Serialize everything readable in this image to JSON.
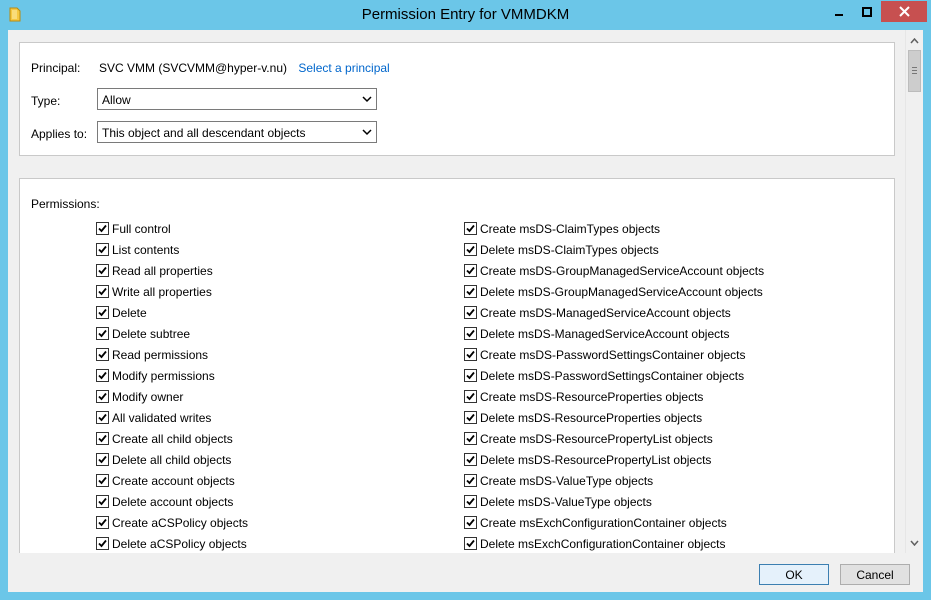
{
  "window": {
    "title": "Permission Entry for VMMDKM",
    "controls": {
      "minimize_icon": "minimize-icon",
      "maximize_icon": "maximize-icon",
      "close_icon": "close-icon"
    },
    "accent_color": "#6bc6e8",
    "close_color": "#c75050"
  },
  "principal": {
    "label": "Principal:",
    "value": "SVC VMM (SVCVMM@hyper-v.nu)",
    "select_link": "Select a principal"
  },
  "type": {
    "label": "Type:",
    "selected": "Allow"
  },
  "applies_to": {
    "label": "Applies to:",
    "selected": "This object and all descendant objects"
  },
  "permissions": {
    "heading": "Permissions:",
    "left": [
      {
        "label": "Full control",
        "checked": true
      },
      {
        "label": "List contents",
        "checked": true
      },
      {
        "label": "Read all properties",
        "checked": true
      },
      {
        "label": "Write all properties",
        "checked": true
      },
      {
        "label": "Delete",
        "checked": true
      },
      {
        "label": "Delete subtree",
        "checked": true
      },
      {
        "label": "Read permissions",
        "checked": true
      },
      {
        "label": "Modify permissions",
        "checked": true
      },
      {
        "label": "Modify owner",
        "checked": true
      },
      {
        "label": "All validated writes",
        "checked": true
      },
      {
        "label": "Create all child objects",
        "checked": true
      },
      {
        "label": "Delete all child objects",
        "checked": true
      },
      {
        "label": "Create account objects",
        "checked": true
      },
      {
        "label": "Delete account objects",
        "checked": true
      },
      {
        "label": "Create aCSPolicy objects",
        "checked": true
      },
      {
        "label": "Delete aCSPolicy objects",
        "checked": true
      }
    ],
    "right": [
      {
        "label": "Create msDS-ClaimTypes objects",
        "checked": true
      },
      {
        "label": "Delete msDS-ClaimTypes objects",
        "checked": true
      },
      {
        "label": "Create msDS-GroupManagedServiceAccount objects",
        "checked": true
      },
      {
        "label": "Delete msDS-GroupManagedServiceAccount objects",
        "checked": true
      },
      {
        "label": "Create msDS-ManagedServiceAccount objects",
        "checked": true
      },
      {
        "label": "Delete msDS-ManagedServiceAccount objects",
        "checked": true
      },
      {
        "label": "Create msDS-PasswordSettingsContainer objects",
        "checked": true
      },
      {
        "label": "Delete msDS-PasswordSettingsContainer objects",
        "checked": true
      },
      {
        "label": "Create msDS-ResourceProperties objects",
        "checked": true
      },
      {
        "label": "Delete msDS-ResourceProperties objects",
        "checked": true
      },
      {
        "label": "Create msDS-ResourcePropertyList objects",
        "checked": true
      },
      {
        "label": "Delete msDS-ResourcePropertyList objects",
        "checked": true
      },
      {
        "label": "Create msDS-ValueType objects",
        "checked": true
      },
      {
        "label": "Delete msDS-ValueType objects",
        "checked": true
      },
      {
        "label": "Create msExchConfigurationContainer objects",
        "checked": true
      },
      {
        "label": "Delete msExchConfigurationContainer objects",
        "checked": true
      }
    ]
  },
  "buttons": {
    "ok": "OK",
    "cancel": "Cancel"
  }
}
